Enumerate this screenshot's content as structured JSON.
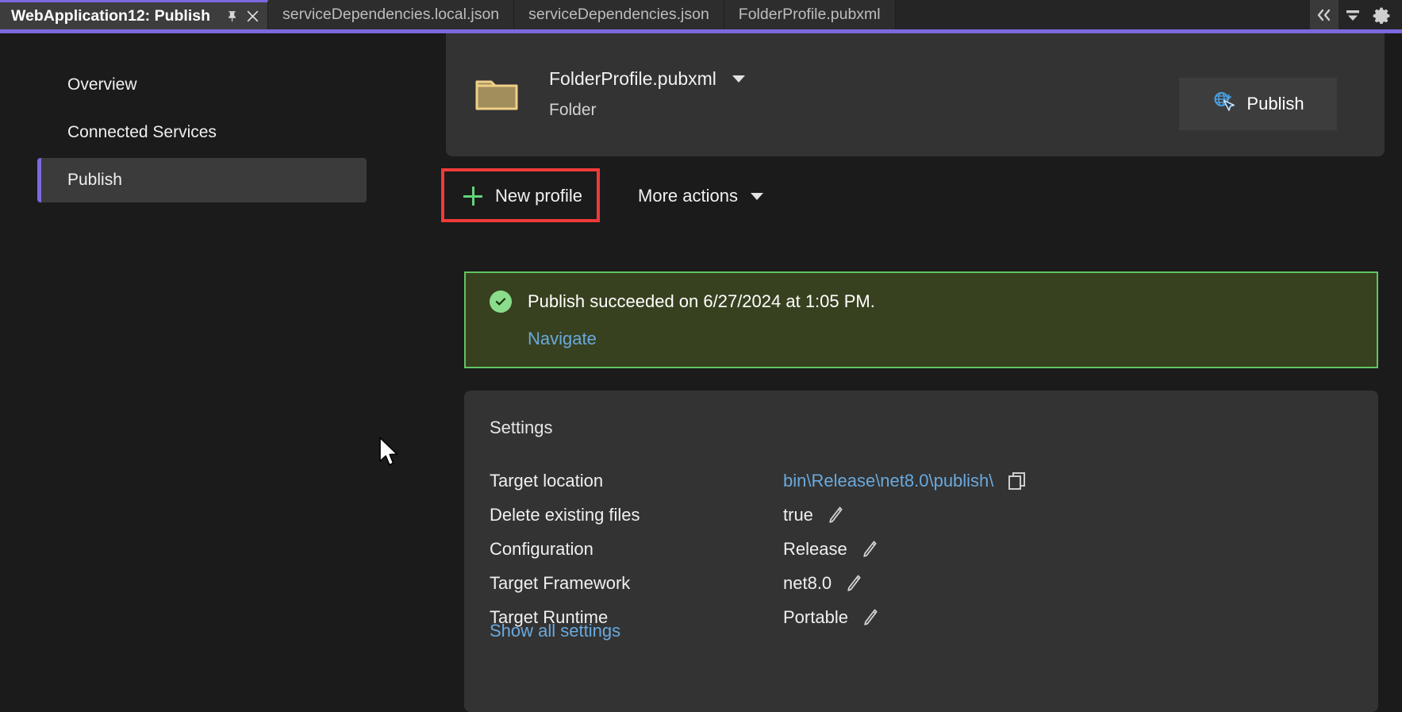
{
  "tabs": [
    {
      "label": "WebApplication12: Publish",
      "active": true,
      "pin_icon": "pin-icon",
      "close_icon": "close-icon"
    },
    {
      "label": "serviceDependencies.local.json",
      "active": false
    },
    {
      "label": "serviceDependencies.json",
      "active": false
    },
    {
      "label": "FolderProfile.pubxml",
      "active": false
    }
  ],
  "tabbar_tools": [
    {
      "name": "chevron-double-left-icon",
      "glyph": "«"
    },
    {
      "name": "dropdown-list-icon",
      "glyph": "▼"
    },
    {
      "name": "gear-icon",
      "glyph": "⚙"
    }
  ],
  "sidebar": {
    "items": [
      {
        "label": "Overview",
        "selected": false
      },
      {
        "label": "Connected Services",
        "selected": false
      },
      {
        "label": "Publish",
        "selected": true
      }
    ]
  },
  "header": {
    "profile_name": "FolderProfile.pubxml",
    "profile_kind": "Folder",
    "folder_icon": "folder-icon",
    "dropdown_icon": "chevron-down-icon",
    "publish_button": {
      "label": "Publish",
      "icon": "globe-click-icon"
    }
  },
  "actions": {
    "new_profile": {
      "label": "New profile",
      "icon": "plus-icon"
    },
    "more_actions": {
      "label": "More actions",
      "icon": "chevron-down-icon"
    }
  },
  "banner": {
    "status_icon": "check-circle-icon",
    "message": "Publish succeeded on 6/27/2024 at 1:05 PM.",
    "link": "Navigate"
  },
  "settings": {
    "title": "Settings",
    "rows": [
      {
        "key": "Target location",
        "value": "bin\\Release\\net8.0\\publish\\",
        "value_is_link": true,
        "action_icon": "copy-icon"
      },
      {
        "key": "Delete existing files",
        "value": "true",
        "value_is_link": false,
        "action_icon": "edit-pencil-icon"
      },
      {
        "key": "Configuration",
        "value": "Release",
        "value_is_link": false,
        "action_icon": "edit-pencil-icon"
      },
      {
        "key": "Target Framework",
        "value": "net8.0",
        "value_is_link": false,
        "action_icon": "edit-pencil-icon"
      },
      {
        "key": "Target Runtime",
        "value": "Portable",
        "value_is_link": false,
        "action_icon": "edit-pencil-icon"
      }
    ],
    "show_all_link": "Show all settings"
  },
  "colors": {
    "accent_purple": "#7d68e0",
    "link_blue": "#6aa9dd",
    "success_green": "#62c462",
    "banner_bg": "#37411f",
    "highlight_red": "#f03a3a",
    "plus_green": "#62d47a",
    "folder_gold": "#f0cf87"
  }
}
